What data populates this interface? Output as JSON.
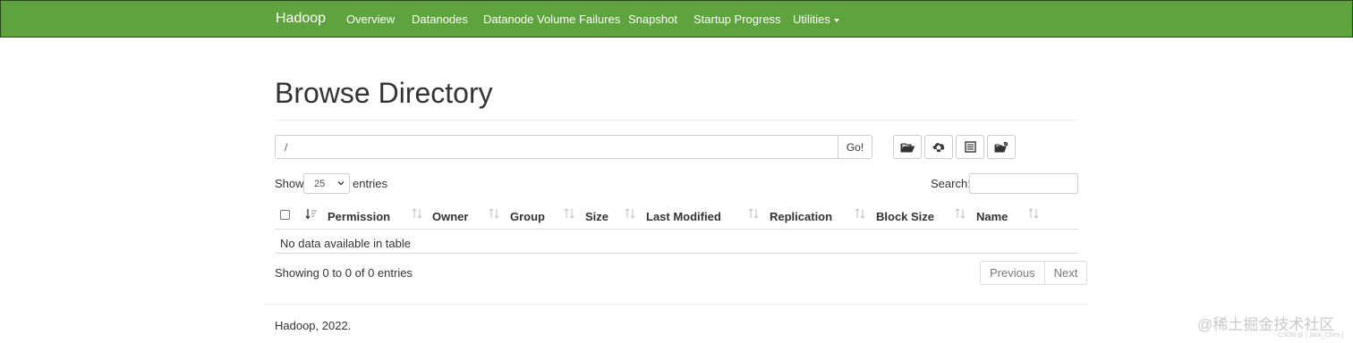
{
  "navbar": {
    "brand": "Hadoop",
    "items": [
      {
        "label": "Overview"
      },
      {
        "label": "Datanodes"
      },
      {
        "label": "Datanode Volume Failures"
      },
      {
        "label": "Snapshot"
      },
      {
        "label": "Startup Progress"
      },
      {
        "label": "Utilities"
      }
    ],
    "color": "#5fa33e"
  },
  "page": {
    "title": "Browse Directory"
  },
  "directory": {
    "path": "/",
    "go_label": "Go!",
    "action_icons": [
      "folder-open-icon",
      "cloud-upload-icon",
      "list-alt-icon",
      "cut-paste-icon"
    ]
  },
  "table_controls": {
    "show_label": "Show",
    "page_length": "25",
    "entries_label": "entries",
    "search_label": "Search:",
    "search_value": ""
  },
  "table": {
    "columns": [
      "Permission",
      "Owner",
      "Group",
      "Size",
      "Last Modified",
      "Replication",
      "Block Size",
      "Name"
    ],
    "empty_message": "No data available in table",
    "info": "Showing 0 to 0 of 0 entries",
    "previous_label": "Previous",
    "next_label": "Next"
  },
  "footer": {
    "text": "Hadoop, 2022."
  },
  "watermark": {
    "text": "@稀土掘金技术社区",
    "sub": "CSDN @ | Jack_Chen |"
  }
}
